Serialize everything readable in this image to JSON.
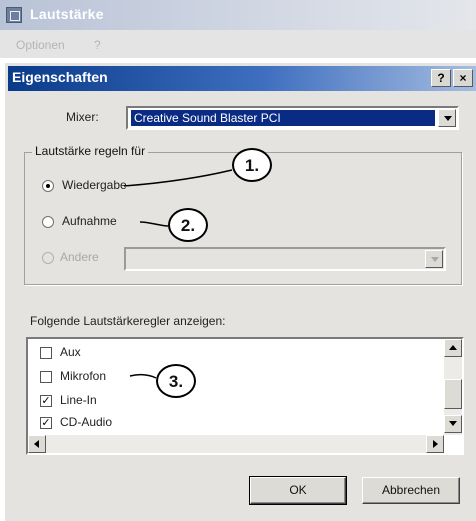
{
  "background_window": {
    "title": "Lautstärke",
    "menu": [
      "Optionen",
      "?"
    ]
  },
  "dialog": {
    "title": "Eigenschaften",
    "help_button": "?",
    "close_button": "×",
    "mixer": {
      "label": "Mixer:",
      "value": "Creative Sound Blaster PCI"
    },
    "control_group": {
      "legend": "Lautstärke regeln für",
      "options": [
        {
          "label": "Wiedergabe",
          "selected": true,
          "enabled": true
        },
        {
          "label": "Aufnahme",
          "selected": false,
          "enabled": true
        },
        {
          "label": "Andere",
          "selected": false,
          "enabled": false
        }
      ]
    },
    "controls_label": "Folgende Lautstärkeregler anzeigen:",
    "controls_list": [
      {
        "label": "Aux",
        "checked": false
      },
      {
        "label": "Mikrofon",
        "checked": false
      },
      {
        "label": "Line-In",
        "checked": true
      },
      {
        "label": "CD-Audio",
        "checked": true
      }
    ],
    "ok_button": "OK",
    "cancel_button": "Abbrechen"
  },
  "callouts": [
    "1.",
    "2.",
    "3."
  ]
}
